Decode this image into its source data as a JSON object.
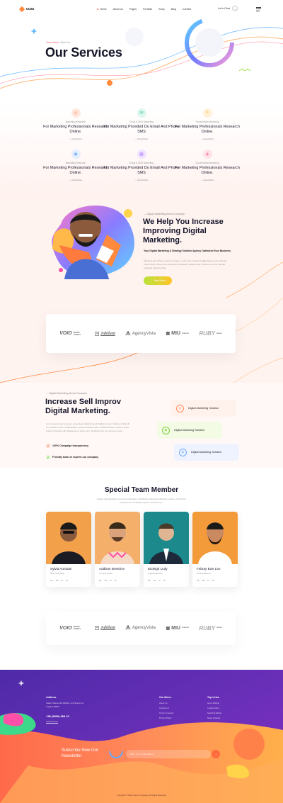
{
  "brand": {
    "name": "ucas"
  },
  "nav": {
    "items": [
      "Home",
      "About us",
      "Pages",
      "Portfolio",
      "Shop",
      "Blog",
      "Contact"
    ],
    "active": "Home",
    "cta": "Let's Chat"
  },
  "breadcrumb": {
    "home": "Ucas Home",
    "sep": " / ",
    "current": "About Us"
  },
  "hero": {
    "title": "Our Services"
  },
  "services": [
    {
      "kicker": "Marketing Research",
      "title": "For Marketing Professionals Research Online.",
      "more": "Read More",
      "icon": "search-icon",
      "color": "#ff8a5c"
    },
    {
      "kicker": "Email & SMS Marketing",
      "title": "For Marketing Provided Do Email And Phone SMS",
      "more": "Read More",
      "icon": "mail-icon",
      "color": "#3ccfa5"
    },
    {
      "kicker": "Social Media Marketing",
      "title": "For Marketing Professionals Research Online.",
      "more": "Read More",
      "icon": "share-icon",
      "color": "#ffb12b"
    },
    {
      "kicker": "Marketing Research",
      "title": "For Marketing Professionals Research Online.",
      "more": "Read More",
      "icon": "target-icon",
      "color": "#6aa8ff"
    },
    {
      "kicker": "Email & SMS Marketing",
      "title": "For Marketing Provided Do Email And Phone SMS",
      "more": "Read More",
      "icon": "chart-icon",
      "color": "#b98aff"
    },
    {
      "kicker": "Social Media Marketing",
      "title": "For Marketing Professionals Research Online.",
      "more": "Read More",
      "icon": "megaphone-icon",
      "color": "#ff6b8a"
    }
  ],
  "marketing": {
    "kicker": "Digital Marketing About Company",
    "title": "We Help You Increase Improving Digital Marketing.",
    "bold": "Your Digital Marketing & Strategy Solution Agency Optimized Your Business.",
    "body": "Mauris at sed id fusce pretium congue a enim duis. Ornare fringilla vitae in purus. Mauris metus purus, efficitur nec lacus sem vestibulum posuere sed. Vivamus et amet, laoreet vulputate faucibus vitae.",
    "button": "Read More"
  },
  "partners": [
    {
      "name": "VOIO",
      "sub": "DIGITAL AGENCY",
      "icon": "voio-logo"
    },
    {
      "name": "Jubilant",
      "sub": "",
      "icon": "jubilant-logo"
    },
    {
      "name": "AgencyVista",
      "sub": "",
      "icon": "agencyvista-logo"
    },
    {
      "name": "MIU",
      "sub": "CREATIVE",
      "icon": "miu-logo"
    },
    {
      "name": "RUBY",
      "sub": "DESIGN",
      "icon": "ruby-logo"
    }
  ],
  "increase": {
    "kicker": "Digital Marketing About Company",
    "title": "Increase Sell Improv Digital Marketing.",
    "body": "Lorem ipsum dolor sit amet, consectetur adipiscing elit. Nullam et sem tristique ac blandit nisl, varius id tortor. Pellentesque pretium interdum velit, ut eleifend diam cursus et amet. Fusce in faucibus elit. Maecenas ut luctus sem, id ultrices nisi, nec tempus metus.",
    "checks": [
      "100% Campaign transparency",
      "Friendly team of experts our company"
    ],
    "pills": [
      "Digital Marketing Solution",
      "Digital Marketing Solution",
      "Digital Marketing Solution"
    ]
  },
  "team": {
    "title": "Special Team Member",
    "subtitle": "Integer vehicula dictum commodo scelerisque. Sollicitudin scelerisque bibendum magna, et bibendum turpis pulvinar. Phasellus egestas hendrerit risus.",
    "members": [
      {
        "name": "Sylvia Aurotani",
        "role": "SEO Specialist",
        "bg": "#f2a14a"
      },
      {
        "name": "Addison Brestrice",
        "role": "Content Writer",
        "bg": "#f4b06b"
      },
      {
        "name": "Etcleigh Lndy",
        "role": "Digital Marketer",
        "bg": "#1c8a8c"
      },
      {
        "name": "Fobray Evie Leo",
        "role": "Email Marketer",
        "bg": "#f39a3a"
      }
    ],
    "social": [
      "Fb",
      "Tw",
      "In",
      "Pi"
    ]
  },
  "footer": {
    "address_head": "Address",
    "address": "Station Warea, Bel Wildfire, 2nd Street Los Angeles 98059",
    "phone": "+58 (9890) 868 22",
    "contact_link": "Contact Store",
    "menu_head": "Our Menu",
    "menu": [
      "About Us",
      "Contact Us",
      "Terms of service",
      "Privacy Policy"
    ],
    "links_head": "Top Links",
    "links": [
      "Get a Shifting",
      "Cookie Policy",
      "Search & Media",
      "News & Media"
    ],
    "subscribe": "Subscribe Now Our Newsletter",
    "placeholder": "Enter your email address",
    "copyright": "Copyright © 2023 ucas by company. All Rights Reserved"
  }
}
